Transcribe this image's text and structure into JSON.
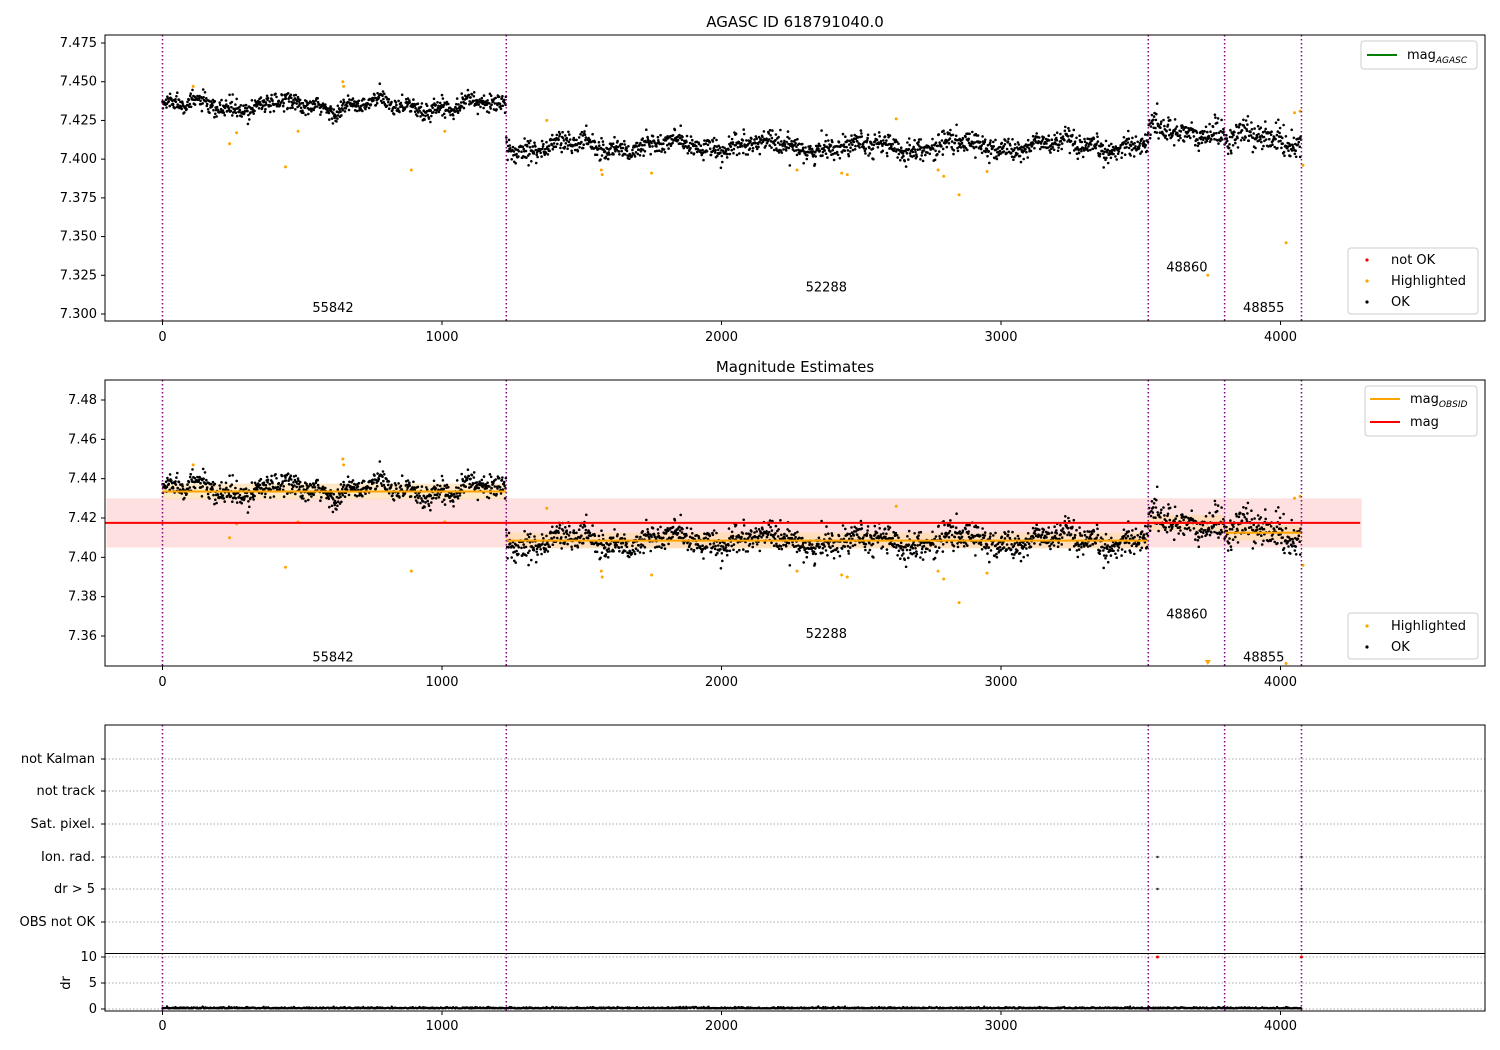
{
  "chart_data": [
    {
      "type": "scatter",
      "title": "AGASC ID 618791040.0",
      "xlim": [
        -200,
        4720
      ],
      "ylim": [
        7.295,
        7.48
      ],
      "yticks": [
        "7.300",
        "7.325",
        "7.350",
        "7.375",
        "7.400",
        "7.425",
        "7.450",
        "7.475"
      ],
      "xticks": [
        "0",
        "1000",
        "2000",
        "3000",
        "4000"
      ],
      "obs_boundaries": [
        0,
        1230,
        3527,
        3800,
        4075
      ],
      "obs_labels": [
        {
          "text": "55842",
          "x": 610,
          "y": 7.304
        },
        {
          "text": "52288",
          "x": 2375,
          "y": 7.317
        },
        {
          "text": "48860",
          "x": 3665,
          "y": 7.33
        },
        {
          "text": "48855",
          "x": 3940,
          "y": 7.304
        }
      ],
      "segments": [
        {
          "x": [
            0,
            1230
          ],
          "mean": 7.4345,
          "noise": 0.004
        },
        {
          "x": [
            1230,
            3527
          ],
          "mean": 7.4085,
          "noise": 0.005
        },
        {
          "x": [
            3527,
            3800
          ],
          "mean": 7.418,
          "noise": 0.006
        },
        {
          "x": [
            3800,
            4075
          ],
          "mean": 7.413,
          "noise": 0.006
        }
      ],
      "highlighted_points": [
        [
          110,
          7.447
        ],
        [
          240,
          7.41
        ],
        [
          265,
          7.417
        ],
        [
          440,
          7.395
        ],
        [
          485,
          7.418
        ],
        [
          645,
          7.45
        ],
        [
          648,
          7.447
        ],
        [
          890,
          7.393
        ],
        [
          1010,
          7.418
        ],
        [
          1375,
          7.425
        ],
        [
          1570,
          7.393
        ],
        [
          1573,
          7.39
        ],
        [
          1750,
          7.391
        ],
        [
          2270,
          7.393
        ],
        [
          2430,
          7.391
        ],
        [
          2450,
          7.39
        ],
        [
          2625,
          7.426
        ],
        [
          2775,
          7.393
        ],
        [
          2795,
          7.389
        ],
        [
          2850,
          7.377
        ],
        [
          2950,
          7.392
        ],
        [
          3740,
          7.325
        ],
        [
          4020,
          7.346
        ],
        [
          4050,
          7.43
        ],
        [
          4070,
          7.431
        ],
        [
          4080,
          7.396
        ]
      ],
      "legend_top": [
        {
          "label": "mag",
          "sub": "AGASC",
          "color": "#008000"
        }
      ],
      "legend_bottom": [
        {
          "label": "not OK",
          "color": "#ff0000"
        },
        {
          "label": "Highlighted",
          "color": "#ffa500"
        },
        {
          "label": "OK",
          "color": "#000000"
        }
      ]
    },
    {
      "type": "scatter",
      "title": "Magnitude Estimates",
      "xlim": [
        -200,
        4720
      ],
      "ylim": [
        7.345,
        7.49
      ],
      "yticks": [
        "7.36",
        "7.38",
        "7.40",
        "7.42",
        "7.44",
        "7.46",
        "7.48"
      ],
      "xticks": [
        "0",
        "1000",
        "2000",
        "3000",
        "4000"
      ],
      "mag": 7.4175,
      "mag_band": [
        7.405,
        7.43
      ],
      "mag_band_x": [
        -200,
        4285
      ],
      "obsid_means": [
        {
          "x": [
            0,
            1230
          ],
          "mean": 7.4335
        },
        {
          "x": [
            1230,
            3527
          ],
          "mean": 7.4085
        },
        {
          "x": [
            3527,
            3800
          ],
          "mean": 7.4175
        },
        {
          "x": [
            3800,
            4075
          ],
          "mean": 7.4125
        }
      ],
      "obs_labels": [
        {
          "text": "55842",
          "x": 610,
          "y": 7.349
        },
        {
          "text": "52288",
          "x": 2375,
          "y": 7.361
        },
        {
          "text": "48860",
          "x": 3665,
          "y": 7.371
        },
        {
          "text": "48855",
          "x": 3940,
          "y": 7.349
        }
      ],
      "legend_top": [
        {
          "label": "mag",
          "sub": "OBSID",
          "color": "#ffa500"
        },
        {
          "label": "mag",
          "sub": "",
          "color": "#ff0000"
        }
      ],
      "legend_bottom": [
        {
          "label": "Highlighted",
          "color": "#ffa500"
        },
        {
          "label": "OK",
          "color": "#000000"
        }
      ]
    },
    {
      "type": "scatter",
      "title": "",
      "flag_labels": [
        "not Kalman",
        "not track",
        "Sat. pixel.",
        "Ion. rad.",
        "dr > 5",
        "OBS not OK"
      ],
      "flag_points": [
        {
          "flag": "Ion. rad.",
          "x": [
            3560,
            4075
          ]
        },
        {
          "flag": "dr > 5",
          "x": [
            3560,
            4075
          ]
        }
      ],
      "dr_ylabel": "dr",
      "dr_yticks": [
        "0",
        "5",
        "10"
      ],
      "dr_ylim": [
        -0.5,
        10.5
      ],
      "dr_outliers": [
        [
          3560,
          10
        ],
        [
          4075,
          10
        ]
      ],
      "xticks": [
        "0",
        "1000",
        "2000",
        "3000",
        "4000"
      ]
    }
  ]
}
